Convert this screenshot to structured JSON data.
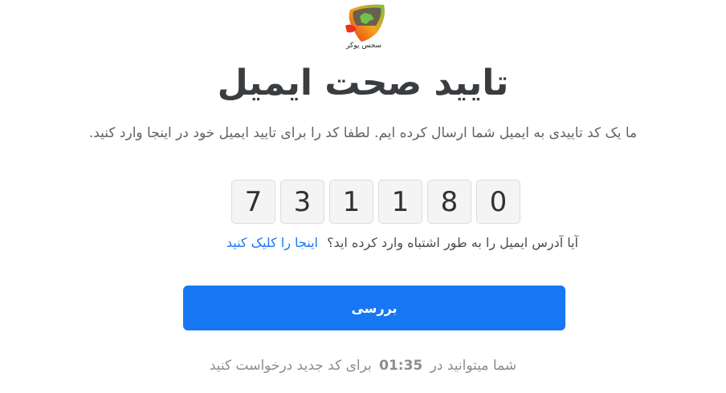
{
  "logo": {
    "text": "سجس پوکر",
    "icon": "poker-logo-icon"
  },
  "title": "تایید صحت ایمیل",
  "subtitle": "ما یک کد تاییدی به ایمیل شما ارسال کرده ایم. لطفا کد را برای تایید ایمیل خود در اینجا وارد کنید.",
  "code": {
    "digits": [
      "7",
      "3",
      "1",
      "1",
      "8",
      "0"
    ]
  },
  "wrong_email": {
    "question": "آیا آدرس ایمیل را به طور اشتباه وارد کرده اید؟",
    "link": "اینجا را کلیک کنید"
  },
  "submit_label": "بررسی",
  "resend": {
    "prefix": "شما میتوانید در",
    "timer": "01:35",
    "suffix": "برای کد جدید درخواست کنید"
  },
  "colors": {
    "accent": "#1877f2",
    "text": "#3a3d40",
    "muted": "#8a8d91"
  }
}
